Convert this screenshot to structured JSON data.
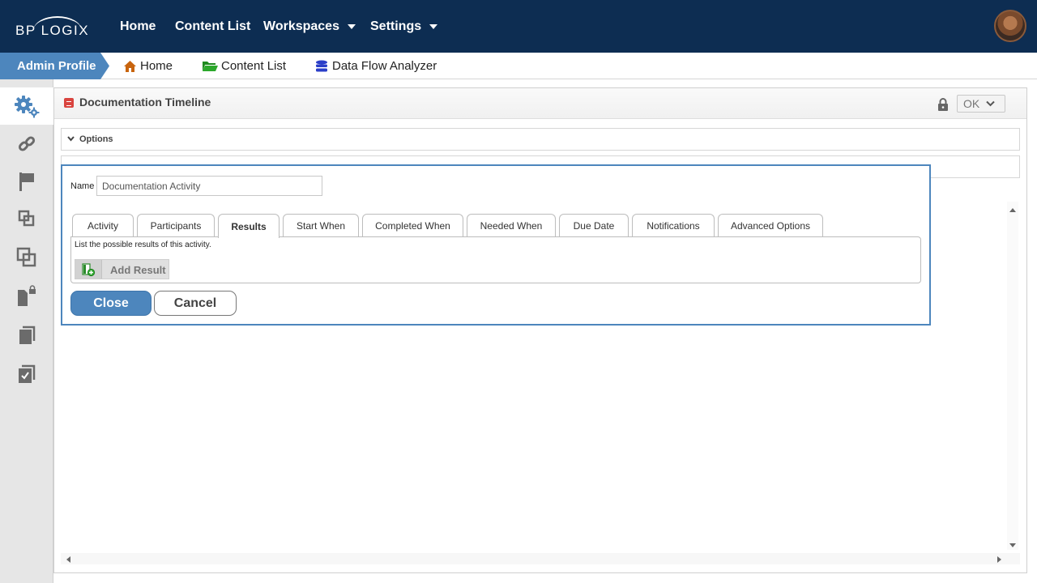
{
  "header": {
    "logo_text": "BP LOGIX",
    "nav": [
      {
        "label": "Home"
      },
      {
        "label": "Content List"
      },
      {
        "label": "Workspaces"
      },
      {
        "label": "Settings"
      }
    ]
  },
  "breadcrumb": {
    "profile": "Admin Profile",
    "items": [
      {
        "label": "Home",
        "icon": "home-icon"
      },
      {
        "label": "Content List",
        "icon": "folder-icon"
      },
      {
        "label": "Data Flow Analyzer",
        "icon": "database-icon"
      }
    ]
  },
  "sidebar": {
    "items": [
      {
        "icon": "gears-icon",
        "active": true
      },
      {
        "icon": "link-icon"
      },
      {
        "icon": "flag-icon"
      },
      {
        "icon": "nested-squares-icon"
      },
      {
        "icon": "overlap-squares-icon"
      },
      {
        "icon": "locked-document-icon"
      },
      {
        "icon": "copy-icon"
      },
      {
        "icon": "checklist-icon"
      }
    ]
  },
  "panel": {
    "title": "Documentation Timeline",
    "ok_label": "OK",
    "options_label": "Options"
  },
  "dialog": {
    "name_label": "Name",
    "name_value": "Documentation Activity",
    "tabs": [
      {
        "label": "Activity"
      },
      {
        "label": "Participants"
      },
      {
        "label": "Results",
        "active": true
      },
      {
        "label": "Start When"
      },
      {
        "label": "Completed When"
      },
      {
        "label": "Needed When"
      },
      {
        "label": "Due Date"
      },
      {
        "label": "Notifications"
      },
      {
        "label": "Advanced Options"
      }
    ],
    "results_description": "List the possible results of this activity.",
    "add_result_label": "Add Result",
    "close_label": "Close",
    "cancel_label": "Cancel"
  },
  "colors": {
    "header_bg": "#0d2d52",
    "accent": "#4d86bd",
    "sidebar_icon": "#6b6b6b",
    "active_sidebar_icon": "#4d86bd"
  }
}
